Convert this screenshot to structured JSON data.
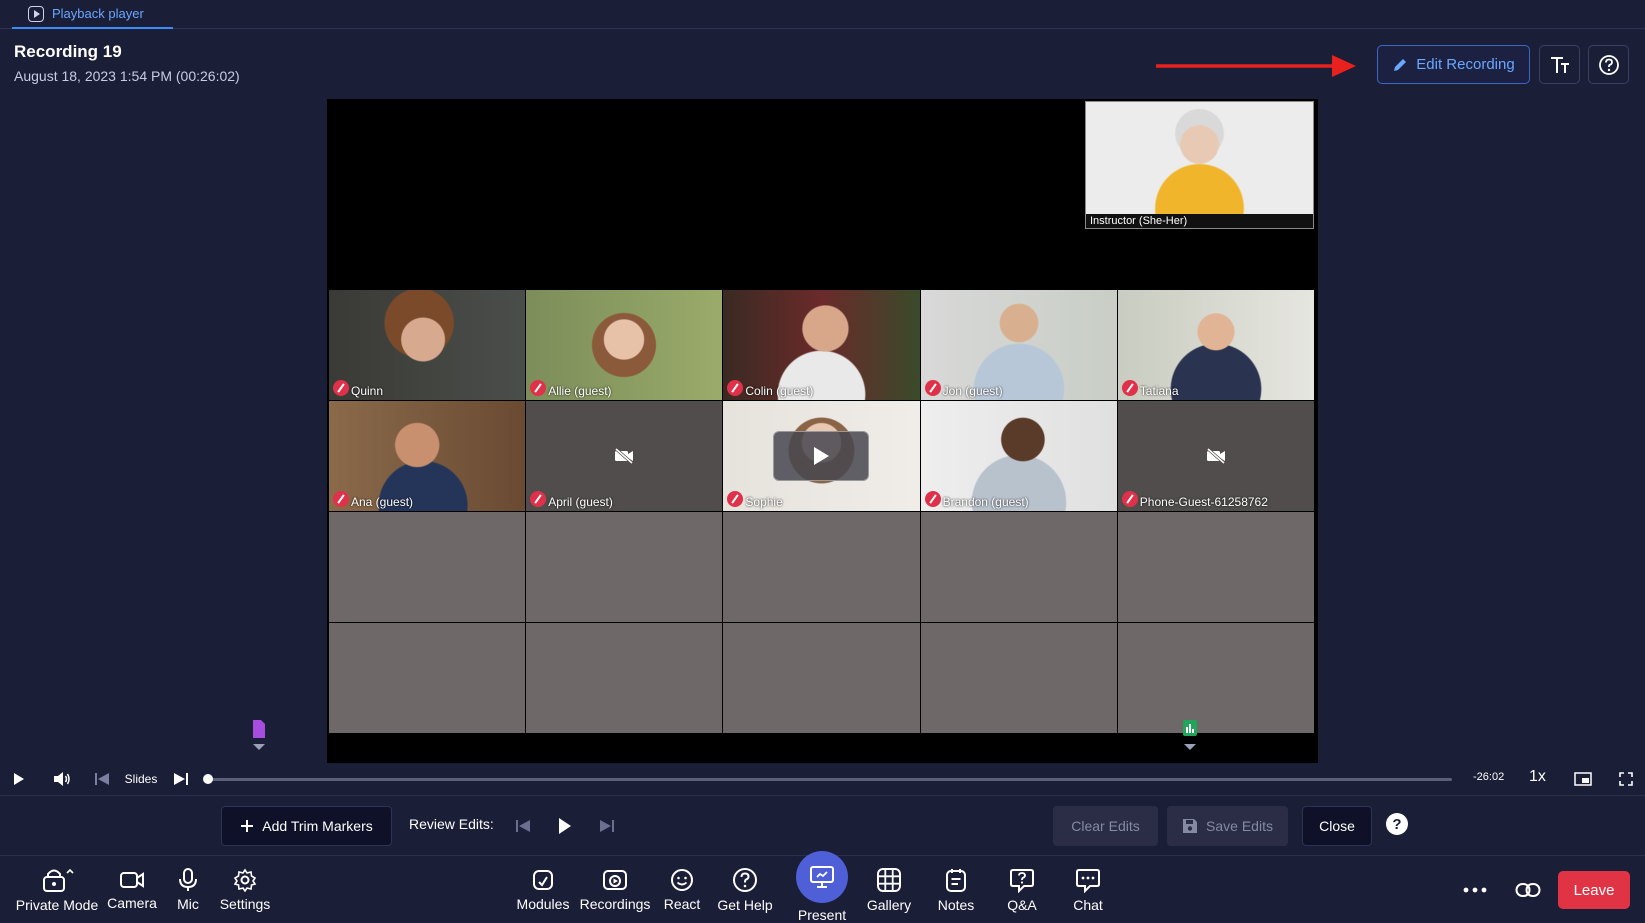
{
  "tab": {
    "label": "Playback player"
  },
  "header": {
    "title": "Recording 19",
    "subtitle": "August 18, 2023 1:54 PM (00:26:02)",
    "edit_button": "Edit Recording"
  },
  "featured": {
    "name": "Instructor (She-Her)"
  },
  "participants": [
    {
      "name": "Quinn",
      "video": true
    },
    {
      "name": "Allie (guest)",
      "video": true
    },
    {
      "name": "Colin (guest)",
      "video": true
    },
    {
      "name": "Jon (guest)",
      "video": true
    },
    {
      "name": "Tatiana",
      "video": true
    },
    {
      "name": "Ana (guest)",
      "video": true
    },
    {
      "name": "April (guest)",
      "video": false
    },
    {
      "name": "Sophie",
      "video": true
    },
    {
      "name": "Brandon (guest)",
      "video": true
    },
    {
      "name": "Phone-Guest-61258762",
      "video": false
    }
  ],
  "player": {
    "slides_label": "Slides",
    "time_remaining": "-26:02",
    "speed": "1x",
    "progress": 0
  },
  "edit_bar": {
    "add_trim": "Add Trim Markers",
    "review_label": "Review Edits:",
    "clear": "Clear Edits",
    "save": "Save Edits",
    "close": "Close",
    "help": "?"
  },
  "toolbar": {
    "left": [
      {
        "id": "private-mode",
        "label": "Private Mode",
        "icon": "lock-icon"
      },
      {
        "id": "camera",
        "label": "Camera",
        "icon": "camera-icon"
      },
      {
        "id": "mic",
        "label": "Mic",
        "icon": "mic-icon"
      },
      {
        "id": "settings",
        "label": "Settings",
        "icon": "gear-icon"
      }
    ],
    "center": [
      {
        "id": "modules",
        "label": "Modules"
      },
      {
        "id": "recordings",
        "label": "Recordings"
      },
      {
        "id": "react",
        "label": "React"
      },
      {
        "id": "get-help",
        "label": "Get Help"
      },
      {
        "id": "present",
        "label": "Present"
      },
      {
        "id": "gallery",
        "label": "Gallery"
      },
      {
        "id": "notes",
        "label": "Notes"
      },
      {
        "id": "qa",
        "label": "Q&A"
      },
      {
        "id": "chat",
        "label": "Chat"
      }
    ],
    "leave": "Leave"
  },
  "colors": {
    "background": "#1b1e37",
    "accent": "#6aa7ff",
    "present": "#4e5fd8",
    "leave": "#e03444",
    "arrow": "#e8211f",
    "mic_off": "#e0314a"
  }
}
